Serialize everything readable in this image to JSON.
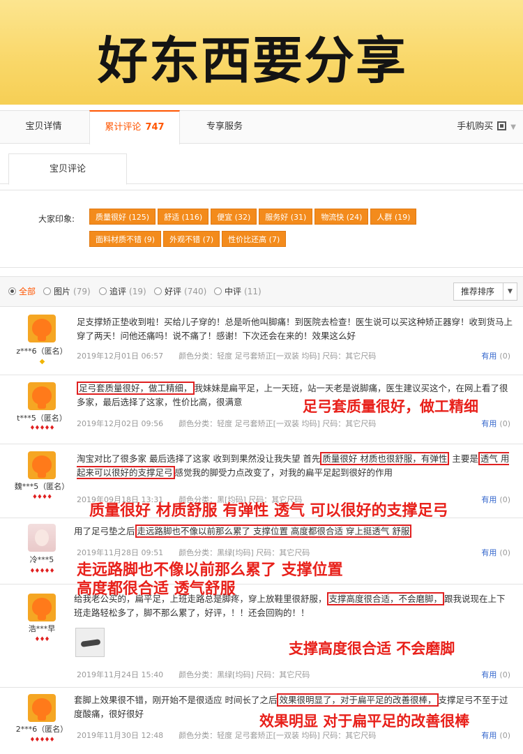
{
  "banner": {
    "title": "好东西要分享"
  },
  "tabs": {
    "details": "宝贝详情",
    "reviews_label": "累计评论",
    "reviews_count": "747",
    "service": "专享服务",
    "mobile_buy": "手机购买"
  },
  "subtab": "宝贝评论",
  "impressions": {
    "label": "大家印象:",
    "tags_row1": [
      "质量很好 (125)",
      "舒适 (116)",
      "便宜 (32)",
      "服务好 (31)",
      "物流快 (24)",
      "人群 (19)"
    ],
    "tags_row2": [
      "面料材质不错 (9)",
      "外观不错 (7)",
      "性价比还高 (7)"
    ]
  },
  "filters": {
    "all": "全部",
    "pic": "图片",
    "pic_n": "(79)",
    "append": "追评",
    "append_n": "(19)",
    "good": "好评",
    "good_n": "(740)",
    "mid": "中评",
    "mid_n": "(11)",
    "sort": "推荐排序"
  },
  "reviews": [
    {
      "user": "z***6（匿名）",
      "text": "足支撑矫正垫收到啦！买给儿子穿的！总是听他叫脚痛！到医院去检查！医生说可以买这种矫正器穿！收到货马上穿了两天！问他还痛吗！说不痛了！感谢！下次还会在来的！效果这么好",
      "date": "2019年12月01日 06:57",
      "spec": "颜色分类：轻度 足弓套矫正[一双装 均码] 尺码：其它尺码",
      "useful": "有用",
      "useful_n": "(0)"
    },
    {
      "user": "t***5（匿名）",
      "text_hl": "足弓套质量很好，做工精细，",
      "text_rest": "我妹妹是扁平足，上一天班，站一天老是说脚痛，医生建议买这个，在网上看了很多家，最后选择了这家，性价比高，很满意",
      "date": "2019年12月02日 09:56",
      "spec": "颜色分类：轻度 足弓套矫正[一双装 均码] 尺码：其它尺码",
      "useful": "有用",
      "useful_n": "(0)",
      "annot": "足弓套质量很好，做工精细"
    },
    {
      "user": "魏***5（匿名）",
      "text_a": "淘宝对比了很多家 最后选择了这家 收到到果然没让我失望 首先",
      "text_hl1": "质量很好 材质也很舒服，有弹性",
      "text_b": " 主要是",
      "text_hl2": "透气 用起来可以很好的支撑足弓",
      "text_c": "感觉我的脚受力点改变了，对我的扁平足起到很好的作用",
      "date": "2019年09月18日 13:31",
      "spec": "颜色分类：黑[均码] 尺码：其它尺码",
      "useful": "有用",
      "useful_n": "(0)",
      "annot": "质量很好  材质舒服  有弹性  透气  可以很好的支撑足弓"
    },
    {
      "user": "冷***5",
      "text_a": "用了足弓垫之后",
      "text_hl": "走远路脚也不像以前那么累了 支撑位置 高度都很合适 穿上挺透气 舒服",
      "date": "2019年11月28日 09:51",
      "spec": "颜色分类：黑绿[均码] 尺码：其它尺码",
      "useful": "有用",
      "useful_n": "(0)",
      "annot1": "走远路脚也不像以前那么累了  支撑位置",
      "annot2": "高度都很合适  透气舒服"
    },
    {
      "user": "浩***早",
      "text_a": "给我老公买的，扁平足，上班走路总是脚疼，穿上放鞋里很舒服，",
      "text_hl": "支撑高度很合适，不会磨脚，",
      "text_b": "跟我说现在上下班走路轻松多了，脚不那么累了，好评，！！还会回购的！！",
      "date": "2019年11月24日 15:40",
      "spec": "颜色分类：黑绿[均码] 尺码：其它尺码",
      "useful": "有用",
      "useful_n": "(0)",
      "annot": "支撑高度很合适  不会磨脚"
    },
    {
      "user": "2***6（匿名）",
      "text_a": "套脚上效果很不错，刚开始不是很适应 时间长了之后",
      "text_hl": "效果很明显了，对于扁平足的改善很棒，",
      "text_b": "支撑足弓不至于过度酸痛，很好很好",
      "date": "2019年11月30日 12:48",
      "spec": "颜色分类：轻度 足弓套矫正[一双装 均码] 尺码：其它尺码",
      "useful": "有用",
      "useful_n": "(0)",
      "annot": "效果明显  对于扁平足的改善很棒"
    }
  ]
}
